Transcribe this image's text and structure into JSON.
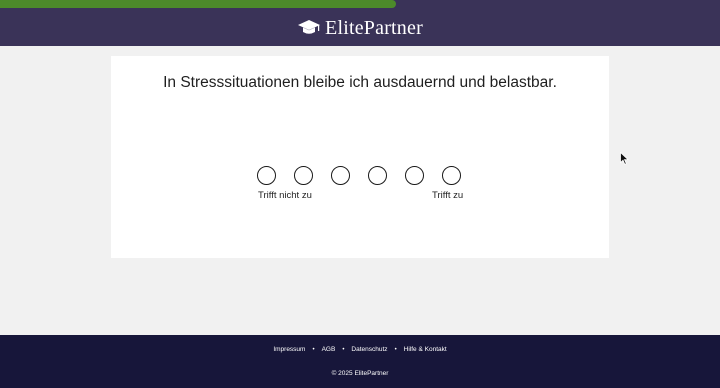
{
  "progress": {
    "percent": 55
  },
  "header": {
    "logo_text": "ElitePartner",
    "logo_icon": "graduation-cap-icon",
    "background": "#3a3358",
    "progress_color": "#4c8a2a"
  },
  "question": {
    "text": "In Stresssituationen bleibe ich ausdauernd und belastbar.",
    "options": [
      "1",
      "2",
      "3",
      "4",
      "5",
      "6"
    ],
    "label_left": "Trifft nicht zu",
    "label_right": "Trifft zu"
  },
  "footer": {
    "links": [
      "Impressum",
      "AGB",
      "Datenschutz",
      "Hilfe & Kontakt"
    ],
    "separator": "•",
    "copyright": "© 2025 ElitePartner",
    "background": "#17163a"
  }
}
